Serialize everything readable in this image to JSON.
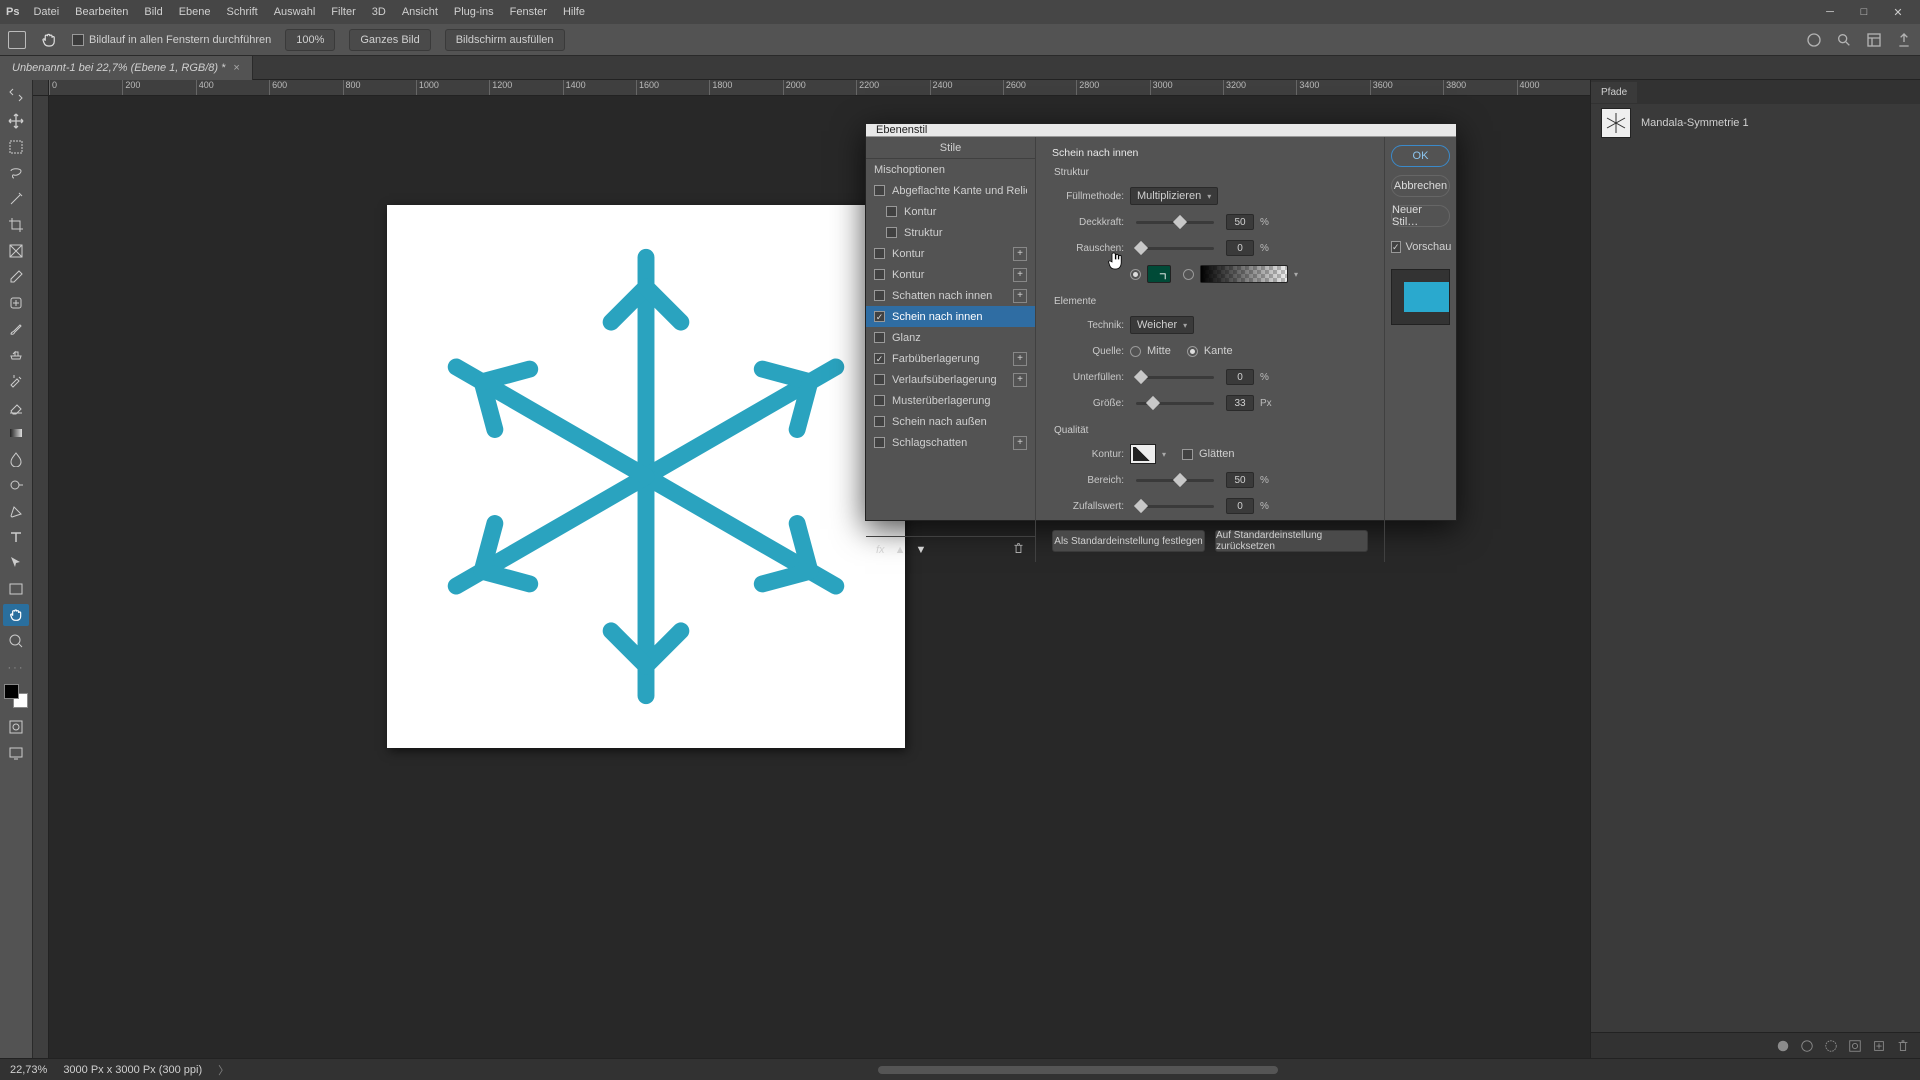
{
  "menu": {
    "items": [
      "Datei",
      "Bearbeiten",
      "Bild",
      "Ebene",
      "Schrift",
      "Auswahl",
      "Filter",
      "3D",
      "Ansicht",
      "Plug-ins",
      "Fenster",
      "Hilfe"
    ]
  },
  "optbar": {
    "scroll_all_label": "Bildlauf in allen Fenstern durchführen",
    "zoom": "100%",
    "fit_label": "Ganzes Bild",
    "fill_label": "Bildschirm ausfüllen"
  },
  "tab": {
    "title": "Unbenannt-1 bei 22,7% (Ebene 1, RGB/8) *"
  },
  "ruler": {
    "ticks": [
      "0",
      "200",
      "400",
      "600",
      "800",
      "1000",
      "1200",
      "1400",
      "1600",
      "1800",
      "2000",
      "2200",
      "2400",
      "2600",
      "2800",
      "3000",
      "3200",
      "3400",
      "3600",
      "3800",
      "4000"
    ]
  },
  "paths_panel": {
    "tab": "Pfade",
    "item": "Mandala-Symmetrie 1"
  },
  "status": {
    "zoom": "22,73%",
    "doc": "3000 Px x 3000 Px (300 ppi)"
  },
  "dialog": {
    "title": "Ebenenstil",
    "left_header": "Stile",
    "blend_opts": "Mischoptionen",
    "styles": [
      {
        "label": "Abgeflachte Kante und Relief",
        "hasCb": true,
        "checked": false,
        "plus": false,
        "indent": 0
      },
      {
        "label": "Kontur",
        "hasCb": true,
        "checked": false,
        "plus": false,
        "indent": 1
      },
      {
        "label": "Struktur",
        "hasCb": true,
        "checked": false,
        "plus": false,
        "indent": 1
      },
      {
        "label": "Kontur",
        "hasCb": true,
        "checked": false,
        "plus": true,
        "indent": 0
      },
      {
        "label": "Kontur",
        "hasCb": true,
        "checked": false,
        "plus": true,
        "indent": 0
      },
      {
        "label": "Schatten nach innen",
        "hasCb": true,
        "checked": false,
        "plus": true,
        "indent": 0
      },
      {
        "label": "Schein nach innen",
        "hasCb": true,
        "checked": true,
        "plus": false,
        "indent": 0,
        "selected": true
      },
      {
        "label": "Glanz",
        "hasCb": true,
        "checked": false,
        "plus": false,
        "indent": 0
      },
      {
        "label": "Farbüberlagerung",
        "hasCb": true,
        "checked": true,
        "plus": true,
        "indent": 0
      },
      {
        "label": "Verlaufsüberlagerung",
        "hasCb": true,
        "checked": false,
        "plus": true,
        "indent": 0
      },
      {
        "label": "Musterüberlagerung",
        "hasCb": true,
        "checked": false,
        "plus": false,
        "indent": 0
      },
      {
        "label": "Schein nach außen",
        "hasCb": true,
        "checked": false,
        "plus": false,
        "indent": 0
      },
      {
        "label": "Schlagschatten",
        "hasCb": true,
        "checked": false,
        "plus": true,
        "indent": 0
      }
    ],
    "panel_title": "Schein nach innen",
    "grp_struct": "Struktur",
    "grp_elem": "Elemente",
    "grp_qual": "Qualität",
    "lbl_blend": "Füllmethode:",
    "val_blend": "Multiplizieren",
    "lbl_opacity": "Deckkraft:",
    "val_opacity": "50",
    "lbl_noise": "Rauschen:",
    "val_noise": "0",
    "lbl_tech": "Technik:",
    "val_tech": "Weicher",
    "lbl_src": "Quelle:",
    "src_center": "Mitte",
    "src_edge": "Kante",
    "lbl_choke": "Unterfüllen:",
    "val_choke": "0",
    "lbl_size": "Größe:",
    "val_size": "33",
    "unit_px": "Px",
    "unit_pct": "%",
    "lbl_contour": "Kontur:",
    "lbl_anti": "Glätten",
    "lbl_range": "Bereich:",
    "val_range": "50",
    "lbl_jitter": "Zufallswert:",
    "val_jitter": "0",
    "btn_default": "Als Standardeinstellung festlegen",
    "btn_reset": "Auf Standardeinstellung zurücksetzen",
    "btn_ok": "OK",
    "btn_cancel": "Abbrechen",
    "btn_newstyle": "Neuer Stil…",
    "lbl_preview": "Vorschau"
  }
}
